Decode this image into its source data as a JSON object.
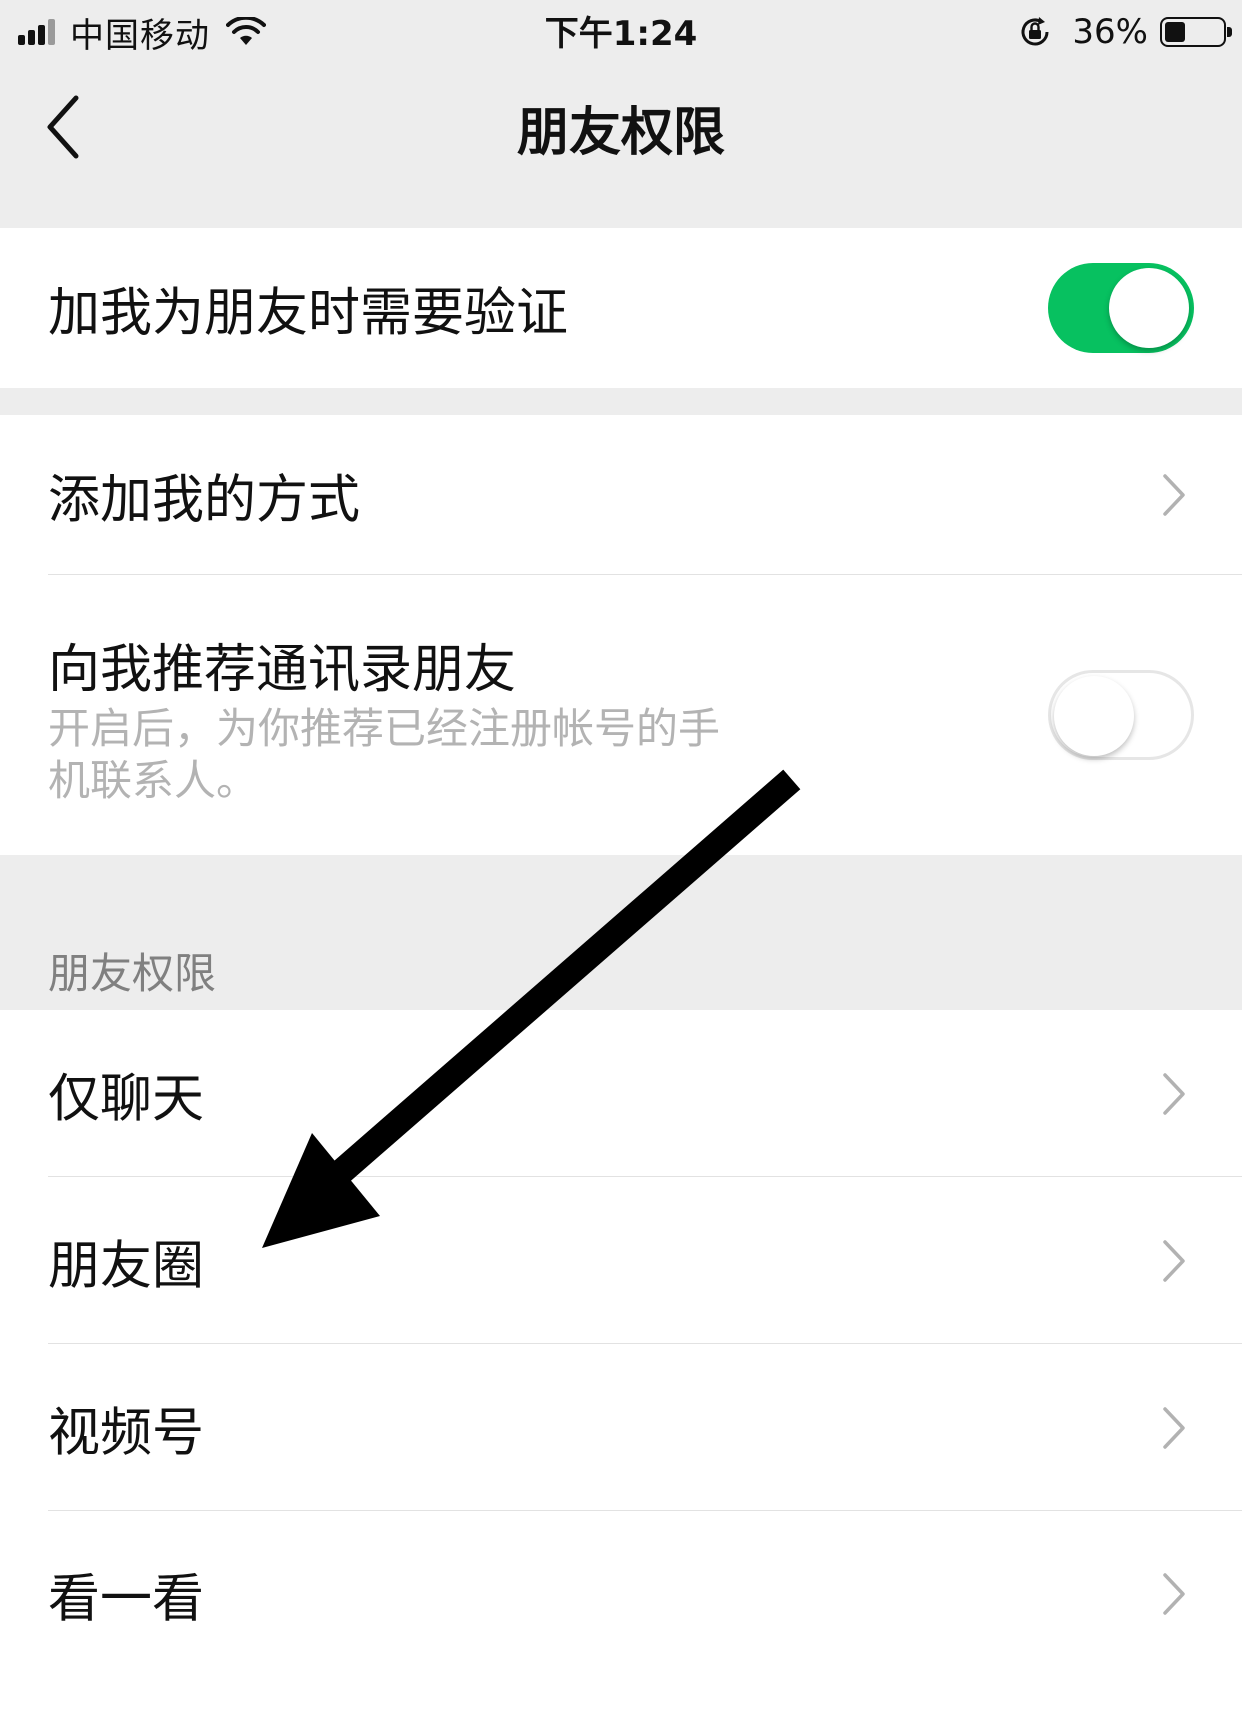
{
  "status_bar": {
    "carrier": "中国移动",
    "time": "下午1:24",
    "battery_percent": "36%",
    "battery_level": 0.36
  },
  "nav": {
    "title": "朋友权限"
  },
  "verify_row": {
    "label": "加我为朋友时需要验证",
    "toggle_on": true
  },
  "add_methods_row": {
    "label": "添加我的方式"
  },
  "recommend_row": {
    "label": "向我推荐通讯录朋友",
    "description": "开启后，为你推荐已经注册帐号的手机联系人。",
    "toggle_on": false
  },
  "permissions_section": {
    "header": "朋友权限",
    "items": [
      {
        "label": "仅聊天"
      },
      {
        "label": "朋友圈"
      },
      {
        "label": "视频号"
      },
      {
        "label": "看一看"
      }
    ]
  },
  "colors": {
    "accent_green": "#07c160",
    "background": "#ededed",
    "secondary_text": "#b3b3b3"
  }
}
